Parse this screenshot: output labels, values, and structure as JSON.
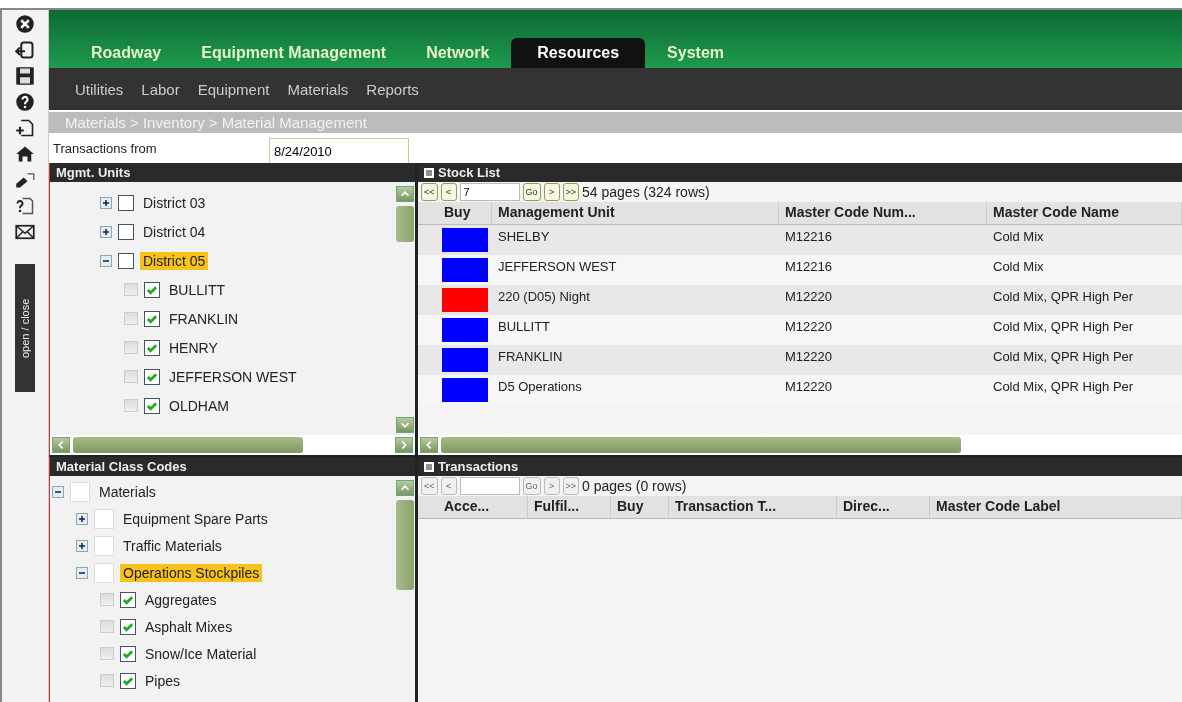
{
  "toolbar": {
    "toggle_label": "open / close"
  },
  "nav": {
    "tabs": [
      {
        "label": "Roadway",
        "selected": false
      },
      {
        "label": "Equipment Management",
        "selected": false
      },
      {
        "label": "Network",
        "selected": false
      },
      {
        "label": "Resources",
        "selected": true
      },
      {
        "label": "System",
        "selected": false
      }
    ],
    "subnav": [
      "Utilities",
      "Labor",
      "Equipment",
      "Materials",
      "Reports"
    ]
  },
  "breadcrumb": "Materials > Inventory > Material Management",
  "filter": {
    "label": "Transactions from",
    "value": "8/24/2010"
  },
  "mgmt_units": {
    "title": "Mgmt. Units",
    "tree": [
      {
        "label": "District 03",
        "expanded": false,
        "checked": false,
        "selected": false
      },
      {
        "label": "District 04",
        "expanded": false,
        "checked": false,
        "selected": false
      },
      {
        "label": "District 05",
        "expanded": true,
        "checked": false,
        "selected": true,
        "children": [
          {
            "label": "BULLITT",
            "checked": true,
            "selected": false
          },
          {
            "label": "FRANKLIN",
            "checked": true,
            "selected": false
          },
          {
            "label": "HENRY",
            "checked": true,
            "selected": false
          },
          {
            "label": "JEFFERSON WEST",
            "checked": true,
            "selected": false
          },
          {
            "label": "OLDHAM",
            "checked": true,
            "selected": false
          }
        ]
      }
    ]
  },
  "material_class_codes": {
    "title": "Material Class Codes",
    "tree": [
      {
        "label": "Materials",
        "expanded": true,
        "checked": false,
        "selected": false,
        "children": [
          {
            "label": "Equipment Spare Parts",
            "expanded": false,
            "checked": false,
            "selected": false
          },
          {
            "label": "Traffic Materials",
            "expanded": false,
            "checked": false,
            "selected": false
          },
          {
            "label": "Operations Stockpiles",
            "expanded": true,
            "checked": false,
            "selected": true,
            "children": [
              {
                "label": "Aggregates",
                "checked": true,
                "selected": false
              },
              {
                "label": "Asphalt Mixes",
                "checked": true,
                "selected": false
              },
              {
                "label": "Snow/Ice Material",
                "checked": true,
                "selected": false
              },
              {
                "label": "Pipes",
                "checked": true,
                "selected": false
              }
            ]
          }
        ]
      }
    ]
  },
  "stock_list": {
    "title": "Stock List",
    "pager": {
      "enabled": true,
      "buttons": [
        "<<",
        "<",
        "Go",
        ">",
        ">>"
      ],
      "page": "7",
      "summary": "54 pages (324 rows)"
    },
    "columns": [
      "Buy",
      "Management Unit",
      "Master Code Num...",
      "Master Code Name"
    ],
    "rows": [
      {
        "color": "#0000ff",
        "management_unit": "SHELBY",
        "code_number": "M12216",
        "code_name": "Cold Mix"
      },
      {
        "color": "#0000ff",
        "management_unit": "JEFFERSON WEST",
        "code_number": "M12216",
        "code_name": "Cold Mix"
      },
      {
        "color": "#ff0000",
        "management_unit": "220 (D05) Night",
        "code_number": "M12220",
        "code_name": "Cold Mix, QPR High Per"
      },
      {
        "color": "#0000ff",
        "management_unit": "BULLITT",
        "code_number": "M12220",
        "code_name": "Cold Mix, QPR High Per"
      },
      {
        "color": "#0000ff",
        "management_unit": "FRANKLIN",
        "code_number": "M12220",
        "code_name": "Cold Mix, QPR High Per"
      },
      {
        "color": "#0000ff",
        "management_unit": "D5 Operations",
        "code_number": "M12220",
        "code_name": "Cold Mix, QPR High Per"
      }
    ]
  },
  "transactions": {
    "title": "Transactions",
    "pager": {
      "enabled": false,
      "buttons": [
        "<<",
        "<",
        "Go",
        ">",
        ">>"
      ],
      "summary": "0 pages (0 rows)"
    },
    "columns": [
      "Acce...",
      "Fulfil...",
      "Buy",
      "Transaction T...",
      "Direc...",
      "Master Code Label"
    ]
  }
}
